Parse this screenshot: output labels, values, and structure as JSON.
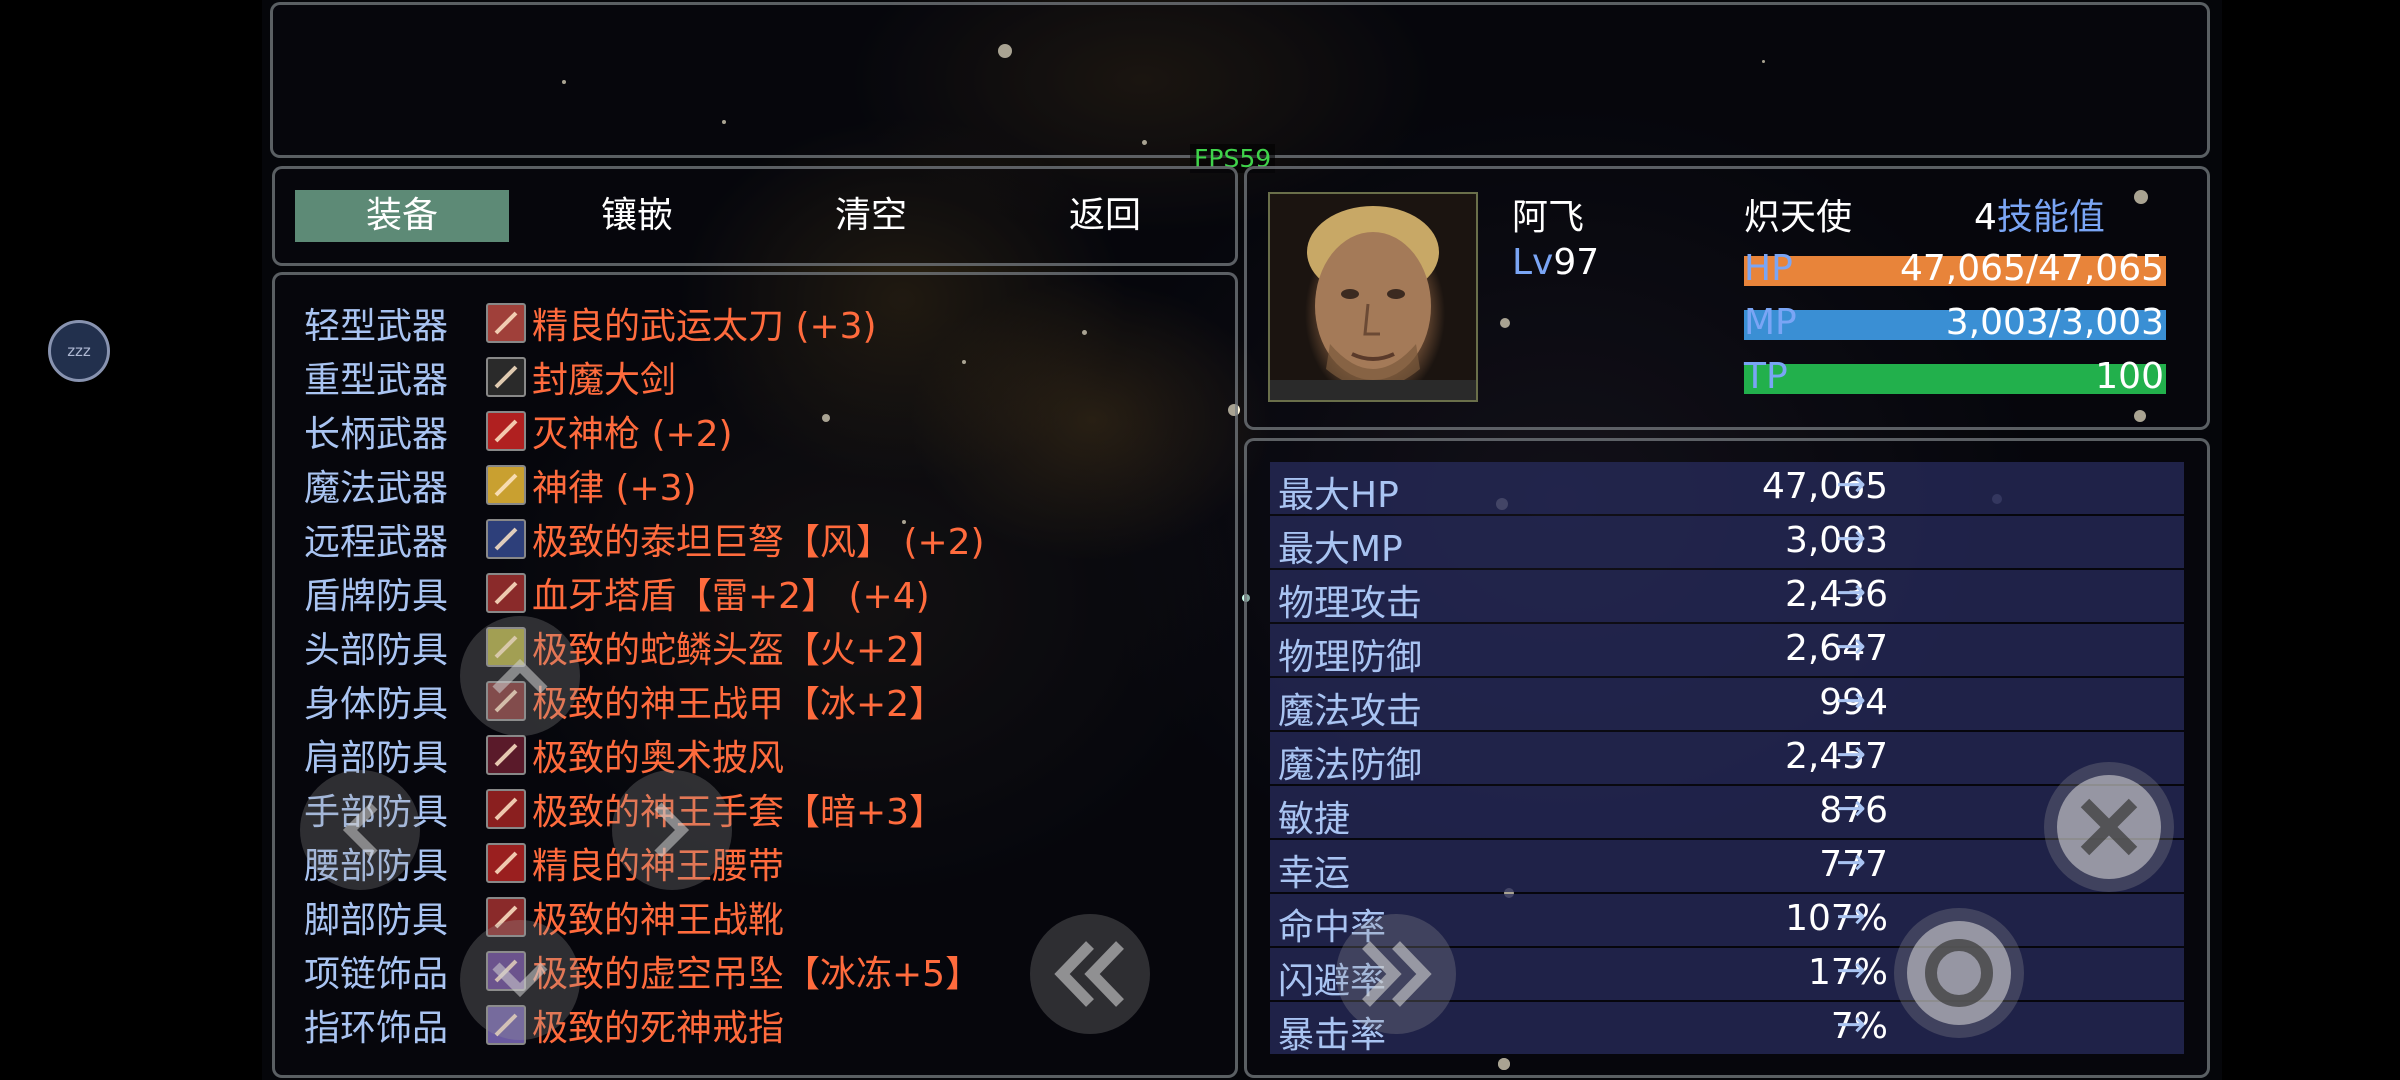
{
  "fps": "FPS59",
  "idle_badge": "zzz",
  "tabs": {
    "equip": "装备",
    "socket": "镶嵌",
    "clear": "清空",
    "back": "返回"
  },
  "slots": [
    {
      "label": "轻型武器",
      "item": "精良的武运太刀 (+3)",
      "icon": "katana-icon",
      "icon_color": "#a0403a"
    },
    {
      "label": "重型武器",
      "item": "封魔大剑",
      "icon": "greatsword-icon",
      "icon_color": "#2a2a2a"
    },
    {
      "label": "长柄武器",
      "item": "灭神枪 (+2)",
      "icon": "spear-icon",
      "icon_color": "#b02020"
    },
    {
      "label": "魔法武器",
      "item": "神律 (+3)",
      "icon": "tome-icon",
      "icon_color": "#c9a030"
    },
    {
      "label": "远程武器",
      "item": "极致的泰坦巨弩【风】 (+2)",
      "icon": "crossbow-icon",
      "icon_color": "#2d3f7a"
    },
    {
      "label": "盾牌防具",
      "item": "血牙塔盾【雷+2】 (+4)",
      "icon": "shield-icon",
      "icon_color": "#8a2a2a"
    },
    {
      "label": "头部防具",
      "item": "极致的蛇鳞头盔【火+2】",
      "icon": "helmet-icon",
      "icon_color": "#a7a23a"
    },
    {
      "label": "身体防具",
      "item": "极致的神王战甲【冰+2】",
      "icon": "armor-icon",
      "icon_color": "#7a3030"
    },
    {
      "label": "肩部防具",
      "item": "极致的奥术披风",
      "icon": "cloak-icon",
      "icon_color": "#5a1a2a"
    },
    {
      "label": "手部防具",
      "item": "极致的神王手套【暗+3】",
      "icon": "gloves-icon",
      "icon_color": "#8a1f1f"
    },
    {
      "label": "腰部防具",
      "item": "精良的神王腰带",
      "icon": "belt-icon",
      "icon_color": "#9a1f1f"
    },
    {
      "label": "脚部防具",
      "item": "极致的神王战靴",
      "icon": "boots-icon",
      "icon_color": "#8a2a2a"
    },
    {
      "label": "项链饰品",
      "item": "极致的虚空吊坠【冰冻+5】",
      "icon": "pendant-icon",
      "icon_color": "#5a3a8a"
    },
    {
      "label": "指环饰品",
      "item": "极致的死神戒指",
      "icon": "ring-icon",
      "icon_color": "#6a5aa0"
    }
  ],
  "character": {
    "name": "阿飞",
    "class": "炽天使",
    "skill_points": "4",
    "skill_label": "技能值",
    "level_prefix": "Lv",
    "level": "97"
  },
  "bars": [
    {
      "label": "HP",
      "value": "47,065/47,065",
      "fill": 1.0,
      "color": "#e8843a"
    },
    {
      "label": "MP",
      "value": "3,003/3,003",
      "fill": 1.0,
      "color": "#3a8fd4"
    },
    {
      "label": "TP",
      "value": "100",
      "fill": 1.0,
      "color": "#22b04c"
    }
  ],
  "stats": [
    {
      "label": "最大HP",
      "value": "47,065"
    },
    {
      "label": "最大MP",
      "value": "3,003"
    },
    {
      "label": "物理攻击",
      "value": "2,436"
    },
    {
      "label": "物理防御",
      "value": "2,647"
    },
    {
      "label": "魔法攻击",
      "value": "994"
    },
    {
      "label": "魔法防御",
      "value": "2,457"
    },
    {
      "label": "敏捷",
      "value": "876"
    },
    {
      "label": "幸运",
      "value": "777"
    },
    {
      "label": "命中率",
      "value": "107%"
    },
    {
      "label": "闪避率",
      "value": "17%"
    },
    {
      "label": "暴击率",
      "value": "7%"
    }
  ],
  "arrow": "→"
}
